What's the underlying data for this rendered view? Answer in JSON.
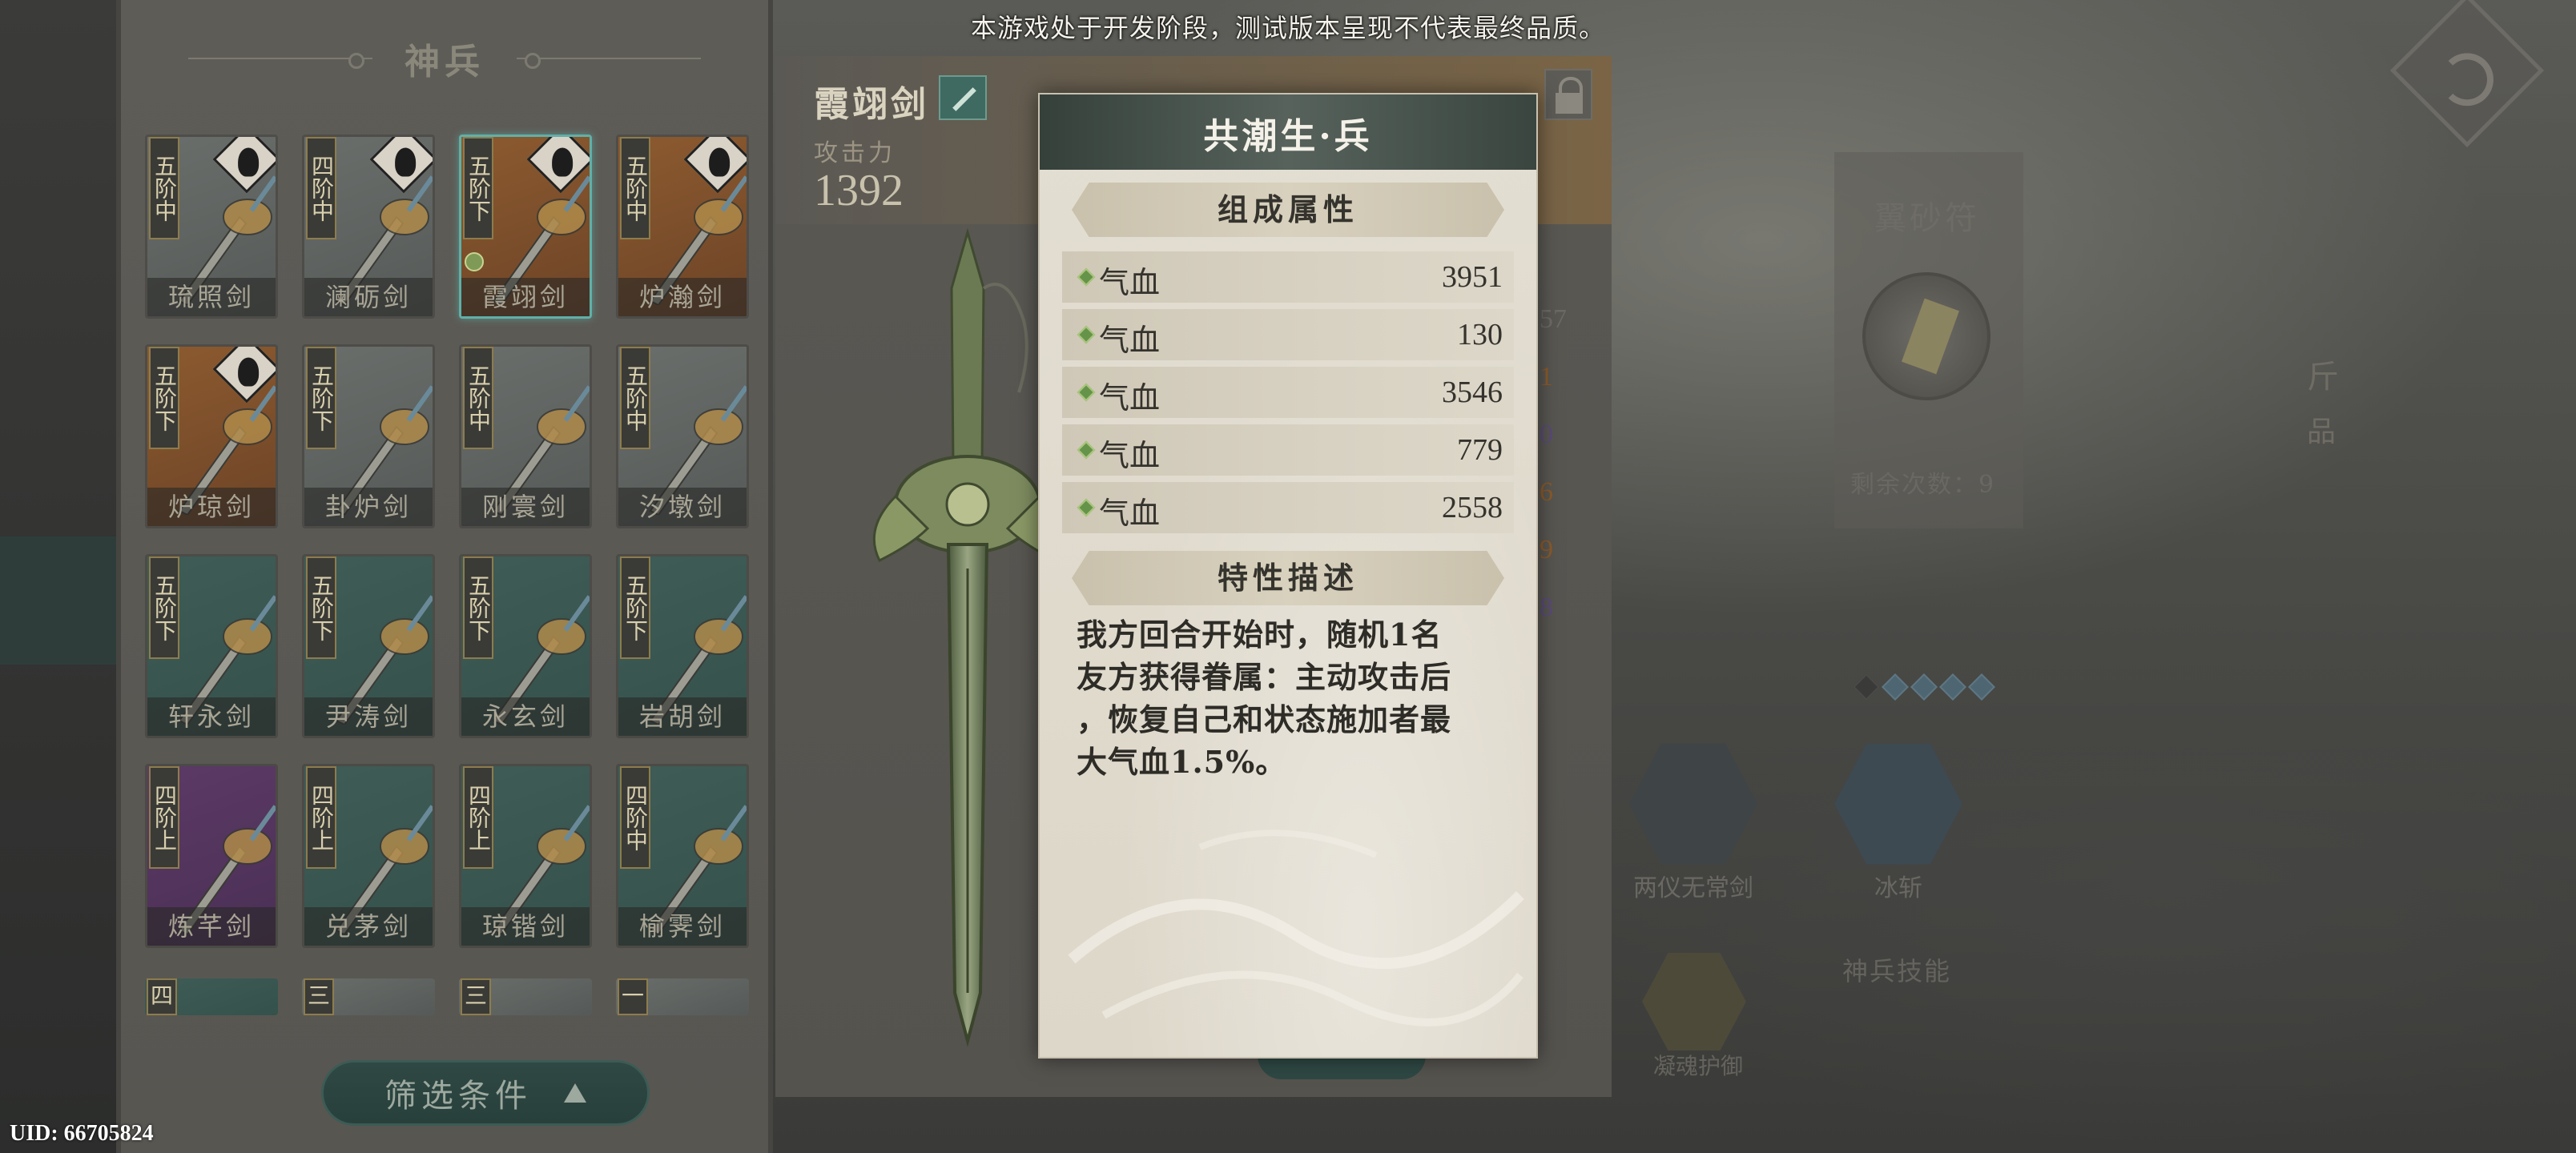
{
  "notice": "本游戏处于开发阶段，测试版本呈现不代表最终品质。",
  "uid": "UID: 66705824",
  "weapon_panel": {
    "title": "神兵",
    "filter_label": "筛选条件",
    "weapons": [
      {
        "name": "琉照剑",
        "tier": "五阶中",
        "bg": "gray",
        "portrait": true,
        "selected": false
      },
      {
        "name": "澜砺剑",
        "tier": "四阶中",
        "bg": "gray",
        "portrait": true,
        "selected": false
      },
      {
        "name": "霞翊剑",
        "tier": "五阶下",
        "bg": "orange",
        "portrait": true,
        "selected": true
      },
      {
        "name": "炉瀚剑",
        "tier": "五阶中",
        "bg": "orange",
        "portrait": true,
        "selected": false
      },
      {
        "name": "炉琼剑",
        "tier": "五阶下",
        "bg": "orange",
        "portrait": true,
        "selected": false
      },
      {
        "name": "卦炉剑",
        "tier": "五阶下",
        "bg": "gray",
        "portrait": false,
        "selected": false
      },
      {
        "name": "刚寰剑",
        "tier": "五阶中",
        "bg": "gray",
        "portrait": false,
        "selected": false
      },
      {
        "name": "汐墩剑",
        "tier": "五阶中",
        "bg": "gray",
        "portrait": false,
        "selected": false
      },
      {
        "name": "轩永剑",
        "tier": "五阶下",
        "bg": "teal",
        "portrait": false,
        "selected": false
      },
      {
        "name": "尹涛剑",
        "tier": "五阶下",
        "bg": "teal",
        "portrait": false,
        "selected": false
      },
      {
        "name": "永玄剑",
        "tier": "五阶下",
        "bg": "teal",
        "portrait": false,
        "selected": false
      },
      {
        "name": "岩胡剑",
        "tier": "五阶下",
        "bg": "teal",
        "portrait": false,
        "selected": false
      },
      {
        "name": "炼芊剑",
        "tier": "四阶上",
        "bg": "purple",
        "portrait": false,
        "selected": false
      },
      {
        "name": "兑茅剑",
        "tier": "四阶上",
        "bg": "teal",
        "portrait": false,
        "selected": false
      },
      {
        "name": "琼锴剑",
        "tier": "四阶上",
        "bg": "teal",
        "portrait": false,
        "selected": false
      },
      {
        "name": "榆霁剑",
        "tier": "四阶中",
        "bg": "teal",
        "portrait": false,
        "selected": false
      }
    ],
    "partial_tiers": [
      "四",
      "三",
      "三",
      "一"
    ]
  },
  "detail": {
    "weapon_name": "霞翊剑",
    "atk_label": "攻击力",
    "atk_value": "1392"
  },
  "right_panel": {
    "rune_title": "翼砂符",
    "rune_remaining": "剩余次数：9",
    "skills_label": "神兵技能",
    "skill1_label": "两仪无常剑",
    "skill2_label": "冰斩",
    "skill3_label": "凝魂护御",
    "bg_chars": [
      "斤",
      "品"
    ],
    "bg_numbers": [
      "57",
      "1",
      "0",
      "6",
      "9",
      "8"
    ],
    "bg_number_colors": [
      "#6b6a64",
      "#8a5a2a",
      "#5a4a7a",
      "#8a5a2a",
      "#8a5a2a",
      "#5a4a7a"
    ]
  },
  "popup": {
    "title": "共潮生·兵",
    "attrs_header": "组成属性",
    "attrs": [
      {
        "name": "气血",
        "value": "3951"
      },
      {
        "name": "气血",
        "value": "130"
      },
      {
        "name": "气血",
        "value": "3546"
      },
      {
        "name": "气血",
        "value": "779"
      },
      {
        "name": "气血",
        "value": "2558"
      }
    ],
    "desc_header": "特性描述",
    "desc_lines": [
      "我方回合开始时，随机1名",
      "友方获得眷属：主动攻击后",
      "，恢复自己和状态施加者最",
      "大气血1.5%。"
    ]
  }
}
